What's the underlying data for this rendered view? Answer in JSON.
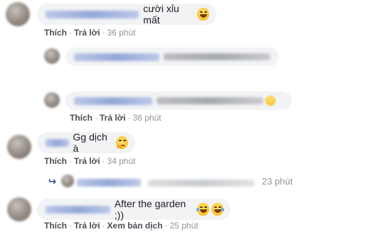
{
  "comments": [
    {
      "text": "cười xỉu mất",
      "emoji": "rolling-on-floor-laughing",
      "actions": {
        "like": "Thích",
        "reply": "Trả lời",
        "time": "36 phút"
      }
    },
    {
      "actions": {
        "like": "Thích",
        "reply": "Trả lời",
        "time": "36 phút"
      }
    },
    {
      "text": "Gg dịch à",
      "emoji": "thinking-face",
      "actions": {
        "like": "Thích",
        "reply": "Trả lời",
        "time": "34 phút"
      }
    },
    {
      "reply_time": "23 phút"
    },
    {
      "text": "After the garden ;))",
      "emoji": "tears-of-joy",
      "actions": {
        "like": "Thích",
        "reply": "Trả lời",
        "translate": "Xem bản dịch",
        "time": "25 phút"
      }
    }
  ],
  "separator": "·"
}
